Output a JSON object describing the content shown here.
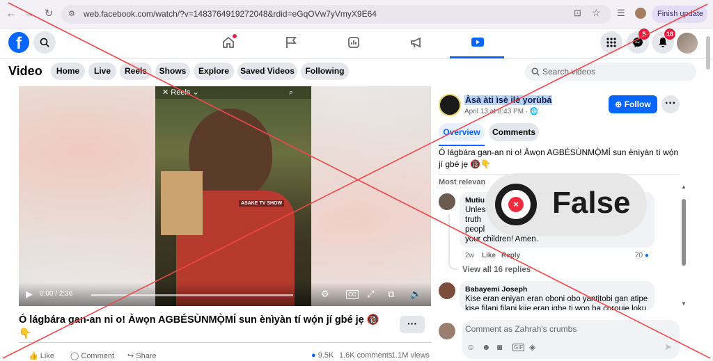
{
  "browser": {
    "url": "web.facebook.com/watch/?v=1483764919272048&rdid=eGqOVw7yVmyX9E64",
    "update_label": "Finish update"
  },
  "fb_header": {
    "logo_letter": "f",
    "messenger_badge": "5",
    "notifications_badge": "18"
  },
  "video_header": {
    "title": "Video",
    "tabs": [
      "Home",
      "Live",
      "Reels",
      "Shows",
      "Explore",
      "Saved Videos",
      "Following"
    ],
    "search_placeholder": "Search videos"
  },
  "player": {
    "reel_label": "Reels",
    "overlay_tag": "ASAKE TV SHOW",
    "time": "0:00 / 2:36",
    "cc_label": "CC"
  },
  "video_title": "Ó lágbára gan-an ni o! Àwọn AGBÉSÙNMỌ̀MÍ sun ènìyàn tí wọ́n jí gbé jẹ 🔞👇",
  "actions": {
    "like": "Like",
    "comment": "Comment",
    "share": "Share",
    "reactions": "9.5K",
    "comments": "1.6K comments",
    "views": "1.1M views"
  },
  "post": {
    "page_name": "Àsà àti ìsè ilè yorùbá",
    "date": "April 13 at 8:43 PM · 🌐",
    "follow_label": "Follow",
    "tabs": [
      "Overview",
      "Comments"
    ],
    "text": "Ó lágbára gan-an ni o! Àwọn AGBÉSÙNMỌ̀MÍ sun ènìyàn tí wọ́n jí gbé jẹ 🔞👇",
    "sort_label": "Most relevan"
  },
  "comments": [
    {
      "name": "Mutiu",
      "lines": [
        "Unles",
        "truth",
        "peopl",
        "your children! Amen."
      ],
      "age": "2w",
      "like": "Like",
      "reply": "Reply",
      "reactions": "70"
    },
    {
      "name": "Babayemi Joseph",
      "lines": [
        "Kise eran eniyan eran oboni obo yantitobi gan atipe",
        "kise filani filani kiie eran igbe ti won ba corouje loku"
      ]
    }
  ],
  "view_replies": "View all 16 replies",
  "comment_box_placeholder": "Comment as Zahrah's crumbs",
  "fact_check": {
    "label": "False",
    "logo_mark": "×",
    "red": "#ef2b3d",
    "cross_color": "#f0474a"
  },
  "colors": {
    "facebook_blue": "#0866ff",
    "badge_red": "#e41e3f"
  }
}
